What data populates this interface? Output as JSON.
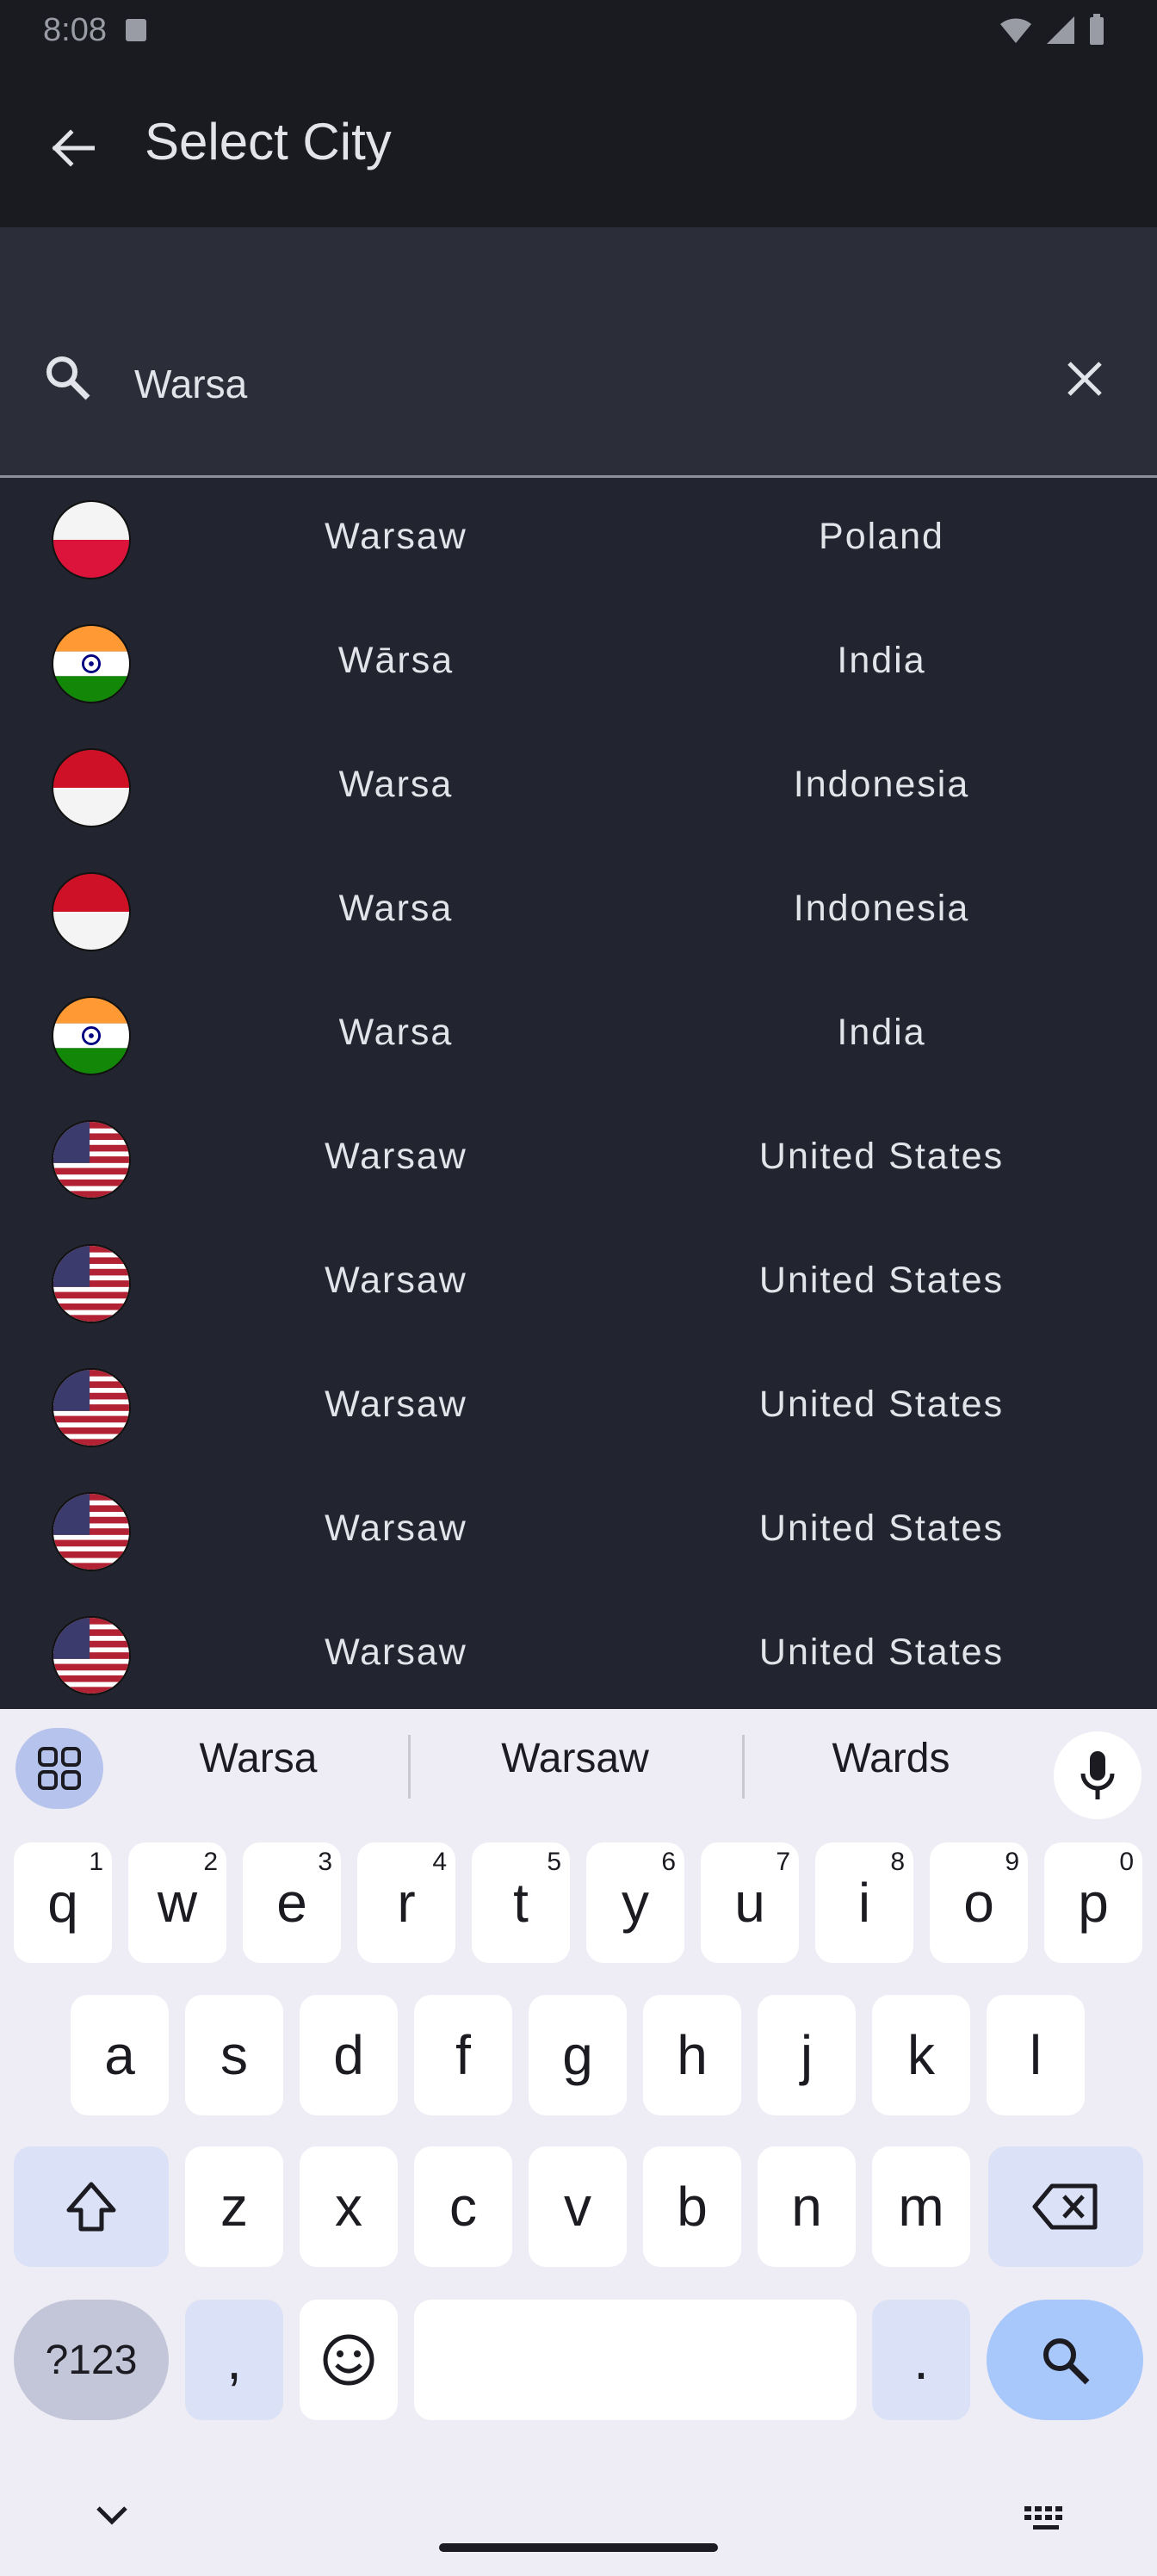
{
  "status_bar": {
    "time": "8:08"
  },
  "app_bar": {
    "title": "Select City"
  },
  "search": {
    "value": "Warsa"
  },
  "cities": [
    {
      "city": "Warsaw",
      "country": "Poland",
      "flag": "poland-flag"
    },
    {
      "city": "Wārsa",
      "country": "India",
      "flag": "india-flag"
    },
    {
      "city": "Warsa",
      "country": "Indonesia",
      "flag": "indonesia-flag"
    },
    {
      "city": "Warsa",
      "country": "Indonesia",
      "flag": "indonesia-flag"
    },
    {
      "city": "Warsa",
      "country": "India",
      "flag": "india-flag"
    },
    {
      "city": "Warsaw",
      "country": "United States",
      "flag": "usa-flag"
    },
    {
      "city": "Warsaw",
      "country": "United States",
      "flag": "usa-flag"
    },
    {
      "city": "Warsaw",
      "country": "United States",
      "flag": "usa-flag"
    },
    {
      "city": "Warsaw",
      "country": "United States",
      "flag": "usa-flag"
    },
    {
      "city": "Warsaw",
      "country": "United States",
      "flag": "usa-flag"
    }
  ],
  "keyboard": {
    "suggestions": [
      "Warsa",
      "Warsaw",
      "Wards"
    ],
    "row1": [
      {
        "key": "q",
        "hint": "1"
      },
      {
        "key": "w",
        "hint": "2"
      },
      {
        "key": "e",
        "hint": "3"
      },
      {
        "key": "r",
        "hint": "4"
      },
      {
        "key": "t",
        "hint": "5"
      },
      {
        "key": "y",
        "hint": "6"
      },
      {
        "key": "u",
        "hint": "7"
      },
      {
        "key": "i",
        "hint": "8"
      },
      {
        "key": "o",
        "hint": "9"
      },
      {
        "key": "p",
        "hint": "0"
      }
    ],
    "row2": [
      "a",
      "s",
      "d",
      "f",
      "g",
      "h",
      "j",
      "k",
      "l"
    ],
    "row3": [
      "z",
      "x",
      "c",
      "v",
      "b",
      "n",
      "m"
    ],
    "symbols_label": "?123",
    "comma_label": ",",
    "period_label": "."
  },
  "colors": {
    "app_bar_bg": "#1a1b20",
    "list_bg": "#22252f",
    "search_bg": "#2b2e39",
    "keyboard_bg": "#eeedf5",
    "accent": "#a8c7fa"
  }
}
